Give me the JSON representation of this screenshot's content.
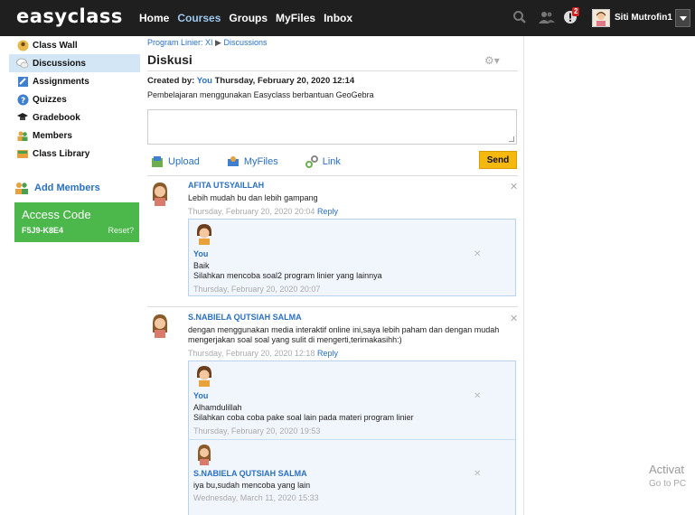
{
  "app": {
    "logo_left": "easy",
    "logo_right": "class",
    "username": "Siti Mutrofin1",
    "notification_count": "2"
  },
  "nav": [
    {
      "label": "Home"
    },
    {
      "label": "Courses"
    },
    {
      "label": "Groups"
    },
    {
      "label": "MyFiles"
    },
    {
      "label": "Inbox"
    }
  ],
  "sidebar": {
    "items": [
      {
        "label": "Class Wall",
        "icon": "wall-icon"
      },
      {
        "label": "Discussions",
        "icon": "discussion-icon"
      },
      {
        "label": "Assignments",
        "icon": "assignment-icon"
      },
      {
        "label": "Quizzes",
        "icon": "quiz-icon"
      },
      {
        "label": "Gradebook",
        "icon": "gradebook-icon"
      },
      {
        "label": "Members",
        "icon": "members-icon"
      },
      {
        "label": "Class Library",
        "icon": "library-icon"
      }
    ],
    "add_members": "Add Members",
    "access_code_label": "Access Code",
    "access_code": "F5J9-K8E4",
    "reset_label": "Reset?"
  },
  "main": {
    "breadcrumb_course": "Program Linier: XI",
    "breadcrumb_page": "Discussions",
    "title": "Diskusi",
    "created_prefix": "Created by:",
    "created_by": "You",
    "created_date": "Thursday, February 20, 2020 12:14",
    "description": "Pembelajaran menggunakan Easyclass berbantuan GeoGebra",
    "upload_label": "Upload",
    "myfiles_label": "MyFiles",
    "link_label": "Link",
    "send_label": "Send"
  },
  "comments": [
    {
      "author": "AFITA UTSYAILLAH",
      "body": "Lebih mudah bu dan lebih gampang",
      "date": "Thursday, February 20, 2020 20:04",
      "reply_label": "Reply",
      "replies": [
        {
          "author": "You",
          "body": "Baik\nSilahkan mencoba soal2 program linier yang lainnya",
          "date": "Thursday, February 20, 2020 20:07"
        }
      ]
    },
    {
      "author": "S.NABIELA QUTSIAH SALMA",
      "body": "dengan menggunakan media interaktif online ini,saya lebih paham dan dengan mudah\nmengerjakan soal soal yang sulit di mengerti,terimakasihh:)",
      "date": "Thursday, February 20, 2020 12:18",
      "reply_label": "Reply",
      "replies": [
        {
          "author": "You",
          "body": "Alhamdulillah\nSilahkan coba coba pake soal lain pada materi program linier",
          "date": "Thursday, February 20, 2020 19:53"
        },
        {
          "author": "S.NABIELA QUTSIAH SALMA",
          "body": "iya bu,sudah mencoba yang lain",
          "date": "Wednesday, March 11, 2020 15:33"
        }
      ]
    }
  ],
  "watermark": {
    "line1": "Activat",
    "line2": "Go to PC"
  },
  "colors": {
    "topbar": "#1f1f1f",
    "link": "#2a70c2",
    "access_code_bg": "#4cb84c",
    "send_button": "#f5b80f"
  }
}
